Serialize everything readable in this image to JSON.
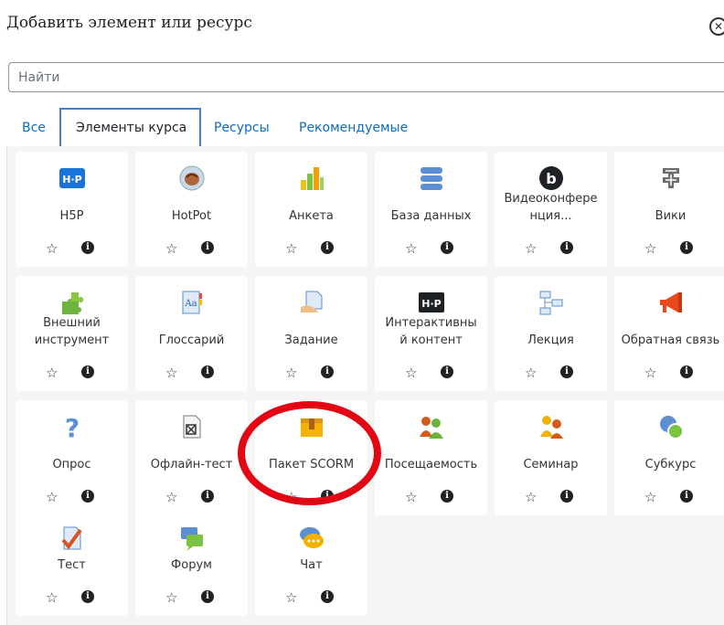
{
  "dialog": {
    "title": "Добавить элемент или ресурс",
    "close_icon": "close-circle-icon"
  },
  "search": {
    "placeholder": "Найти",
    "value": ""
  },
  "tabs": [
    {
      "label": "Все",
      "active": false
    },
    {
      "label": "Элементы курса",
      "active": true
    },
    {
      "label": "Ресурсы",
      "active": false
    },
    {
      "label": "Рекомендуемые",
      "active": false
    }
  ],
  "modules": [
    {
      "name": "H5P",
      "icon": "h5p-icon"
    },
    {
      "name": "HotPot",
      "icon": "hotpot-icon"
    },
    {
      "name": "Анкета",
      "icon": "bar-chart-icon"
    },
    {
      "name": "База данных",
      "icon": "database-icon"
    },
    {
      "name": "Видеоконфере\nнция...",
      "icon": "bigbluebutton-icon"
    },
    {
      "name": "Вики",
      "icon": "wiki-icon"
    },
    {
      "name": "Внешний\nинструмент",
      "icon": "puzzle-icon"
    },
    {
      "name": "Глоссарий",
      "icon": "glossary-icon"
    },
    {
      "name": "Задание",
      "icon": "assignment-icon"
    },
    {
      "name": "Интерактивны\nй контент",
      "icon": "h5p-dark-icon"
    },
    {
      "name": "Лекция",
      "icon": "lesson-icon"
    },
    {
      "name": "Обратная связь",
      "icon": "megaphone-icon"
    },
    {
      "name": "Опрос",
      "icon": "question-icon"
    },
    {
      "name": "Офлайн-тест",
      "icon": "offline-quiz-icon"
    },
    {
      "name": "Пакет SCORM",
      "icon": "scorm-package-icon"
    },
    {
      "name": "Посещаемость",
      "icon": "attendance-icon"
    },
    {
      "name": "Семинар",
      "icon": "workshop-icon"
    },
    {
      "name": "Субкурс",
      "icon": "subcourse-icon"
    },
    {
      "name": "Тест",
      "icon": "quiz-icon"
    },
    {
      "name": "Форум",
      "icon": "forum-icon"
    },
    {
      "name": "Чат",
      "icon": "chat-icon"
    }
  ],
  "colors": {
    "link": "#0f6cbf",
    "active_tab_border": "#4a7fc0",
    "highlight": "#e30613"
  }
}
